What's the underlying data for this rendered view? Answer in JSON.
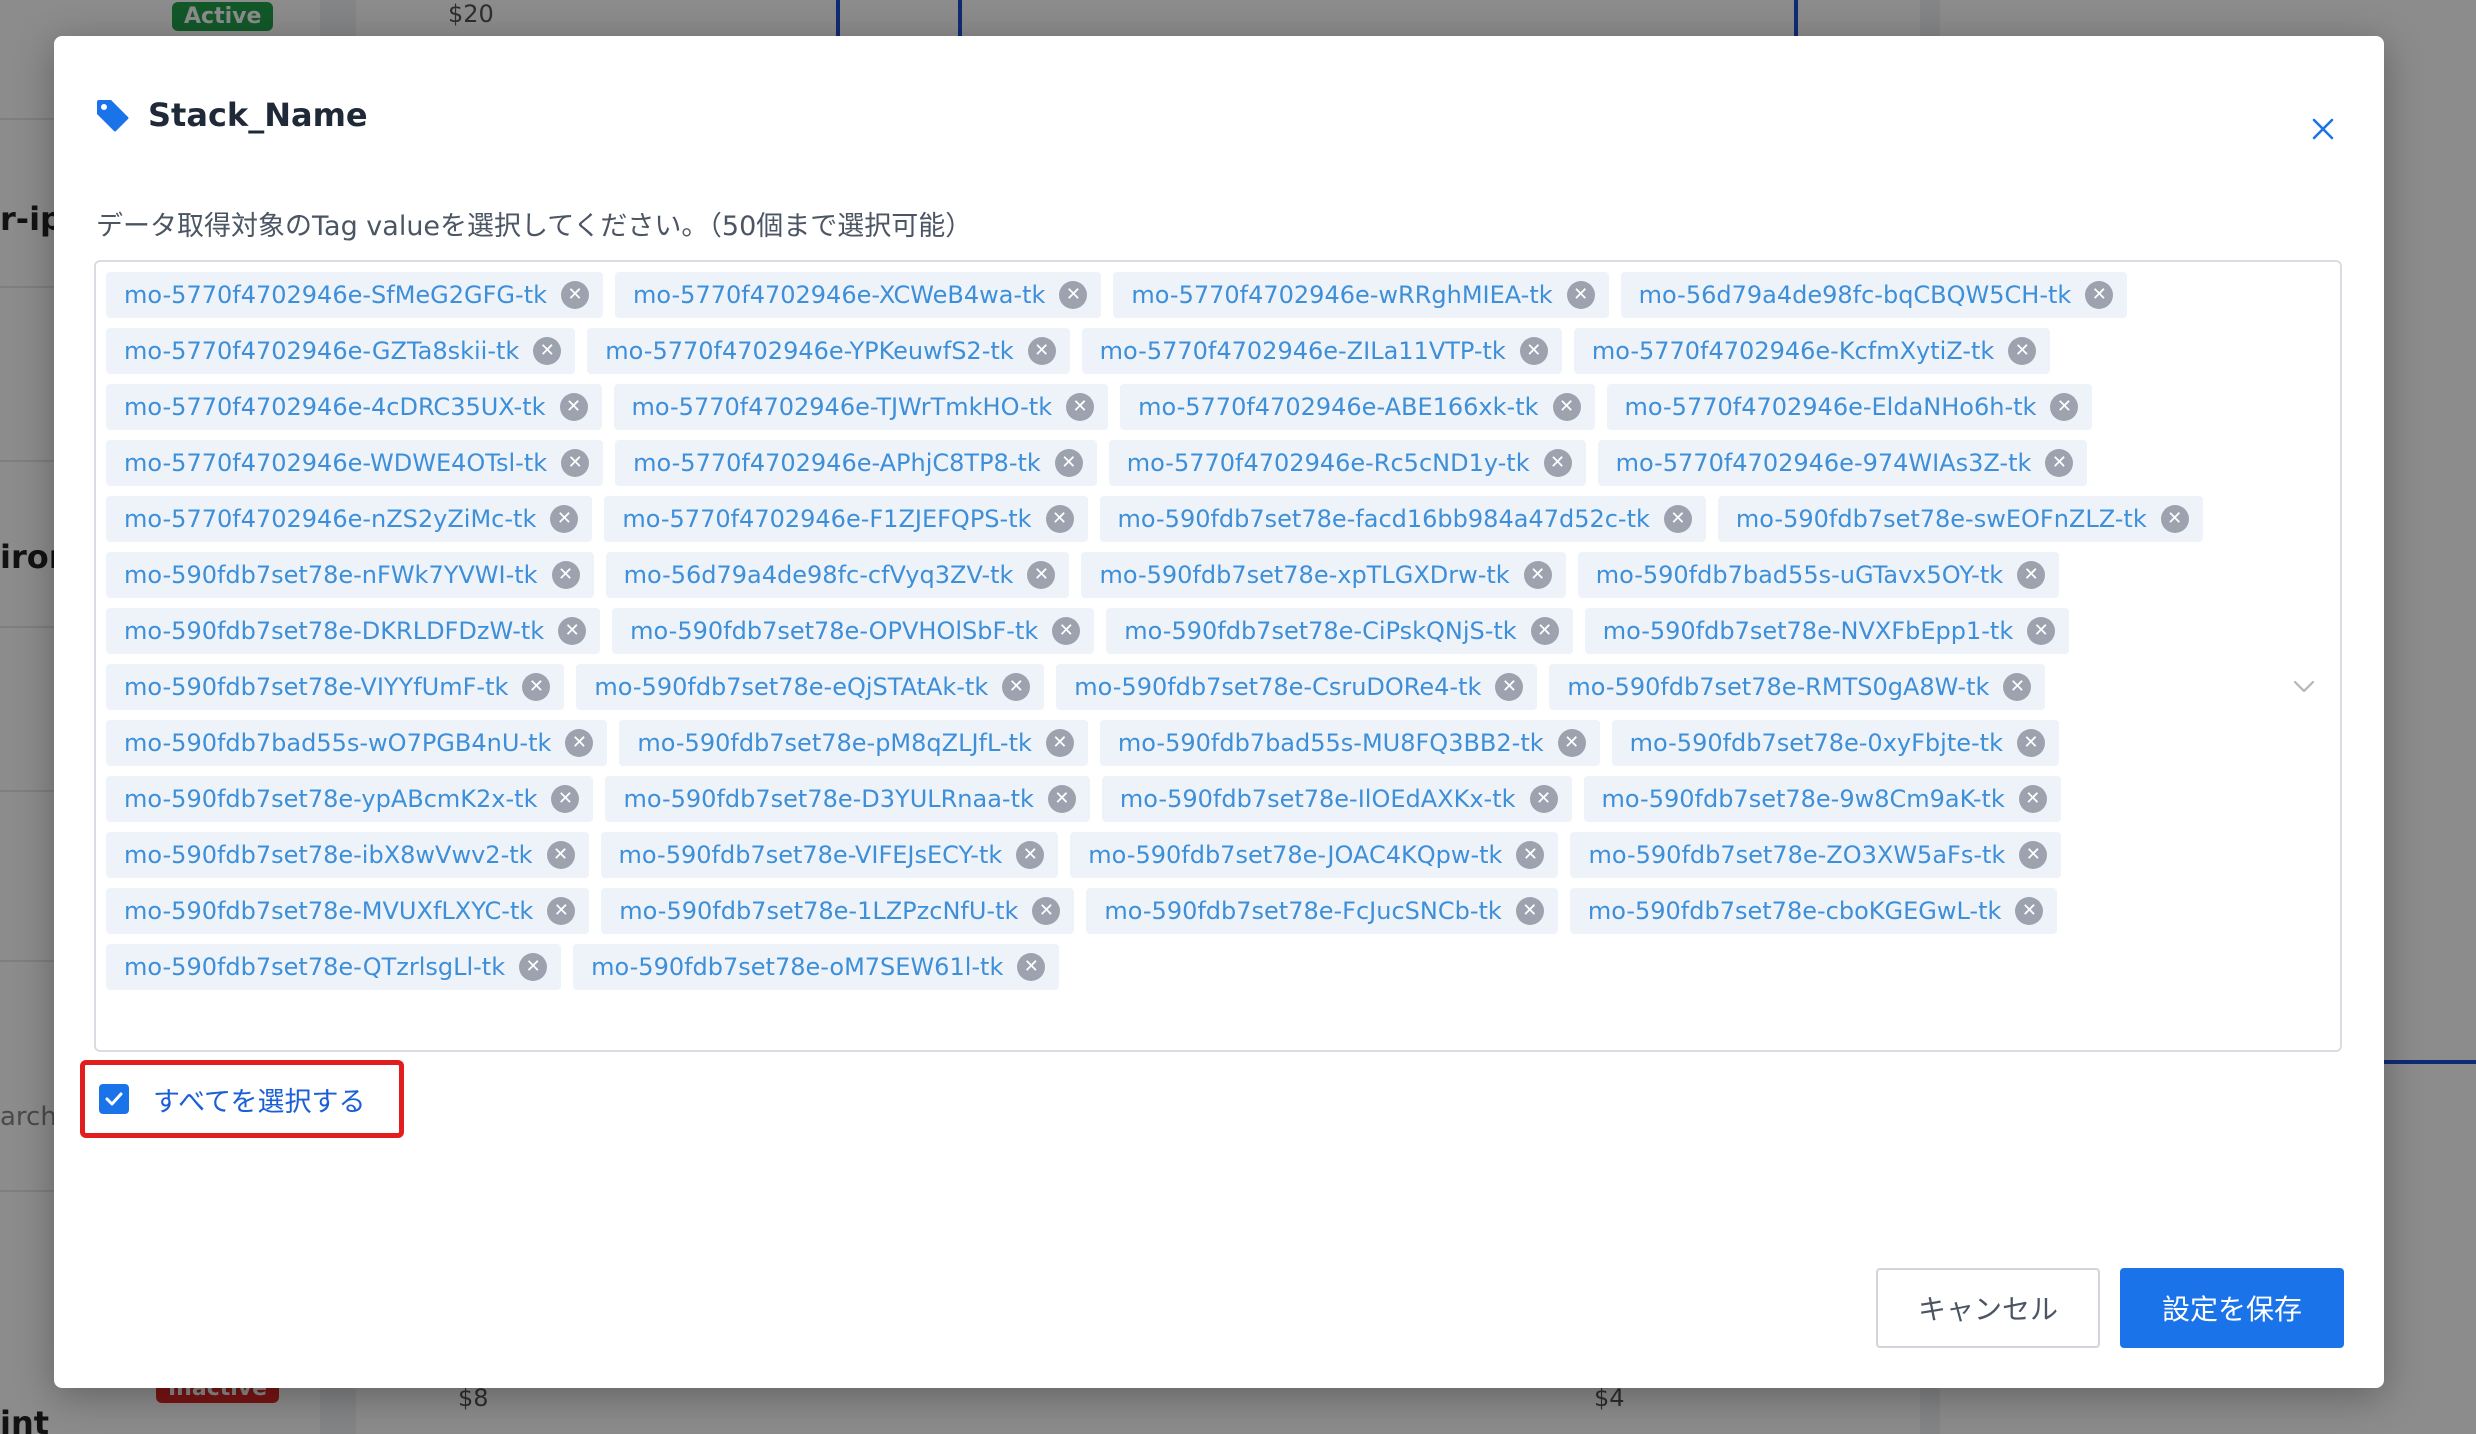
{
  "background": {
    "badges": {
      "active": "Active",
      "inactive": "Inactive"
    },
    "axis_labels": {
      "top_left": "$20",
      "bottom_left": "$8",
      "bottom_right": "$4"
    },
    "left_fragments": [
      "r-ip",
      "iron",
      "arch.",
      "int"
    ]
  },
  "modal": {
    "title": "Stack_Name",
    "description": "データ取得対象のTag valueを選択してください。（50個まで選択可能）",
    "tags": [
      "mo-5770f4702946e-SfMeG2GFG-tk",
      "mo-5770f4702946e-XCWeB4wa-tk",
      "mo-5770f4702946e-wRRghMIEA-tk",
      "mo-56d79a4de98fc-bqCBQW5CH-tk",
      "mo-5770f4702946e-GZTa8skii-tk",
      "mo-5770f4702946e-YPKeuwfS2-tk",
      "mo-5770f4702946e-ZILa11VTP-tk",
      "mo-5770f4702946e-KcfmXytiZ-tk",
      "mo-5770f4702946e-4cDRC35UX-tk",
      "mo-5770f4702946e-TJWrTmkHO-tk",
      "mo-5770f4702946e-ABE166xk-tk",
      "mo-5770f4702946e-EldaNHo6h-tk",
      "mo-5770f4702946e-WDWE4OTsl-tk",
      "mo-5770f4702946e-APhjC8TP8-tk",
      "mo-5770f4702946e-Rc5cND1y-tk",
      "mo-5770f4702946e-974WIAs3Z-tk",
      "mo-5770f4702946e-nZS2yZiMc-tk",
      "mo-5770f4702946e-F1ZJEFQPS-tk",
      "mo-590fdb7set78e-facd16bb984a47d52c-tk",
      "mo-590fdb7set78e-swEOFnZLZ-tk",
      "mo-590fdb7set78e-nFWk7YVWI-tk",
      "mo-56d79a4de98fc-cfVyq3ZV-tk",
      "mo-590fdb7set78e-xpTLGXDrw-tk",
      "mo-590fdb7bad55s-uGTavx5OY-tk",
      "mo-590fdb7set78e-DKRLDFDzW-tk",
      "mo-590fdb7set78e-OPVHOlSbF-tk",
      "mo-590fdb7set78e-CiPskQNjS-tk",
      "mo-590fdb7set78e-NVXFbEpp1-tk",
      "mo-590fdb7set78e-VIYYfUmF-tk",
      "mo-590fdb7set78e-eQjSTAtAk-tk",
      "mo-590fdb7set78e-CsruDORe4-tk",
      "mo-590fdb7set78e-RMTS0gA8W-tk",
      "mo-590fdb7bad55s-wO7PGB4nU-tk",
      "mo-590fdb7set78e-pM8qZLJfL-tk",
      "mo-590fdb7bad55s-MU8FQ3BB2-tk",
      "mo-590fdb7set78e-0xyFbjte-tk",
      "mo-590fdb7set78e-ypABcmK2x-tk",
      "mo-590fdb7set78e-D3YULRnaa-tk",
      "mo-590fdb7set78e-IlOEdAXKx-tk",
      "mo-590fdb7set78e-9w8Cm9aK-tk",
      "mo-590fdb7set78e-ibX8wVwv2-tk",
      "mo-590fdb7set78e-VIFEJsECY-tk",
      "mo-590fdb7set78e-JOAC4KQpw-tk",
      "mo-590fdb7set78e-ZO3XW5aFs-tk",
      "mo-590fdb7set78e-MVUXfLXYC-tk",
      "mo-590fdb7set78e-1LZPzcNfU-tk",
      "mo-590fdb7set78e-FcJucSNCb-tk",
      "mo-590fdb7set78e-cboKGEGwL-tk",
      "mo-590fdb7set78e-QTzrlsgLl-tk",
      "mo-590fdb7set78e-oM7SEW61l-tk"
    ],
    "select_all_label": "すべてを選択する",
    "select_all_checked": true,
    "cancel_label": "キャンセル",
    "save_label": "設定を保存"
  },
  "colors": {
    "accent": "#1a73e8",
    "chip_bg": "#eef3f9",
    "chip_text": "#3d8fd9",
    "highlight": "#e11d1d"
  },
  "icons": {
    "title": "tag-icon",
    "close": "close-icon",
    "chip_remove": "clear-circle-icon",
    "dropdown": "chevron-down-icon",
    "checkbox": "checkmark-icon"
  }
}
